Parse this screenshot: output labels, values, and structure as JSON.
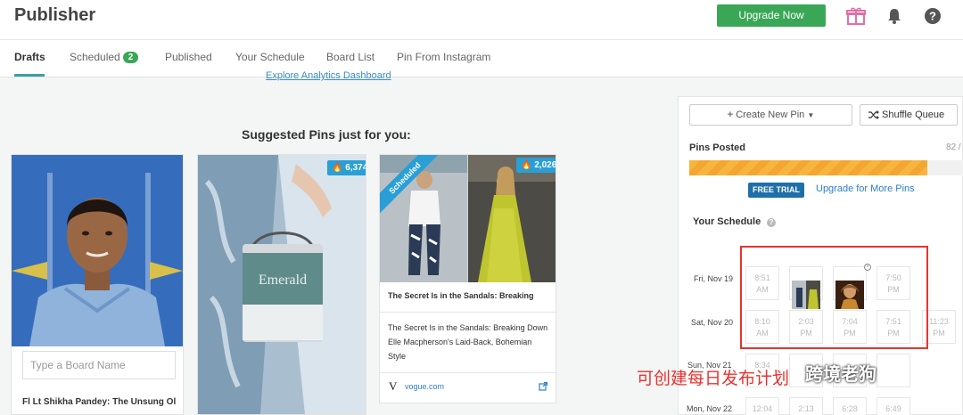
{
  "app": {
    "title": "Publisher",
    "upgrade_label": "Upgrade Now"
  },
  "icons": {
    "gift": "gift-icon",
    "bell": "bell-icon",
    "help": "help-icon"
  },
  "tabs": [
    {
      "label": "Drafts"
    },
    {
      "label": "Scheduled",
      "badge": "2"
    },
    {
      "label": "Published"
    },
    {
      "label": "Your Schedule"
    },
    {
      "label": "Board List"
    },
    {
      "label": "Pin From Instagram"
    }
  ],
  "analytics_link": "Explore Analytics Dashboard",
  "suggested": {
    "title": "Suggested Pins just for you:",
    "card1": {
      "board_placeholder": "Type a Board Name",
      "caption": "Fl Lt Shikha Pandey: The Unsung Ol"
    },
    "card2": {
      "repins": "6,374",
      "can_label": "Emerald"
    },
    "card3": {
      "repins": "2,026",
      "ribbon": "Scheduled",
      "title": "The Secret Is in the Sandals: Breaking",
      "description": "The Secret Is in the Sandals: Breaking Down Elle Macpherson's Laid-Back, Bohemian Style",
      "source": "vogue.com"
    }
  },
  "right_panel": {
    "create_label": "Create New Pin",
    "shuffle_label": "Shuffle Queue",
    "pins_posted_label": "Pins Posted",
    "pins_posted_count": "82 /",
    "progress_fraction": 0.87,
    "free_trial": "FREE TRIAL",
    "upgrade_more": "Upgrade for More Pins",
    "your_schedule": "Your Schedule",
    "days": [
      {
        "label": "Fri, Nov 19",
        "slots": [
          "8:51\nAM",
          "",
          "",
          "7:50\nPM"
        ]
      },
      {
        "label": "Sat, Nov 20",
        "slots": [
          "8:10\nAM",
          "2:03\nPM",
          "7:04\nPM",
          "7:51\nPM",
          "11:23\nPM"
        ]
      },
      {
        "label": "Sun, Nov 21",
        "slots": [
          "8:34",
          "",
          "",
          ""
        ]
      },
      {
        "label": "Mon, Nov 22",
        "slots": [
          "12:04",
          "2:13",
          "6:28",
          "6:49"
        ]
      }
    ]
  },
  "overlay": {
    "annotation": "可创建每日发布计划",
    "watermark": "跨境老狗"
  },
  "colors": {
    "accent_green": "#3aa757",
    "teal": "#3aa0a0",
    "blue": "#2a9fd6",
    "red_box": "#e8332f"
  }
}
